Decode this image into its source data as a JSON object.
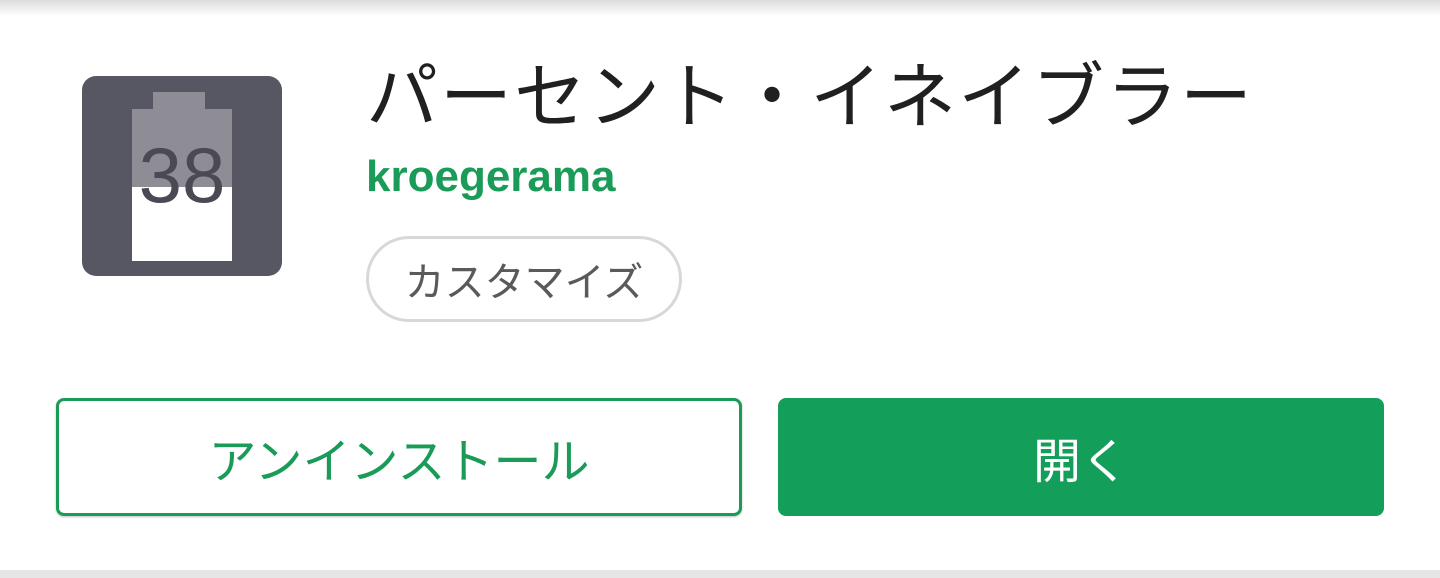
{
  "app": {
    "title": "パーセント・イネイブラー",
    "developer": "kroegerama",
    "category": "カスタマイズ",
    "icon": {
      "name": "battery-percentage-icon",
      "number": "38",
      "colors": {
        "background": "#575663",
        "battery_upper": "#8e8d96",
        "battery_lower": "#ffffff",
        "digits": "#4a4a55"
      }
    }
  },
  "actions": {
    "uninstall_label": "アンインストール",
    "open_label": "開く"
  },
  "colors": {
    "accent": "#1a9b58",
    "open_button": "#139e5a"
  }
}
